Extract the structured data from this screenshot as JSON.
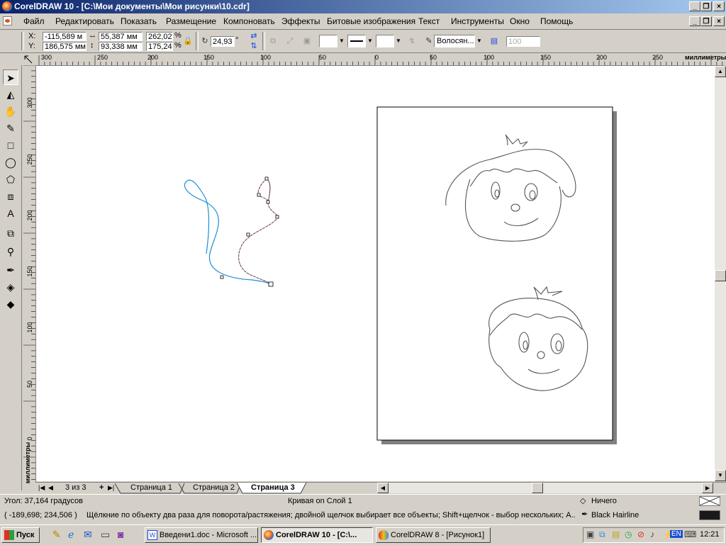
{
  "window": {
    "title": "CorelDRAW 10 - [C:\\Мои документы\\Мои рисунки\\10.cdr]"
  },
  "menu": {
    "items": [
      "Файл",
      "Редактировать",
      "Показать",
      "Размещение",
      "Компоновать",
      "Эффекты",
      "Битовые изображения",
      "Текст",
      "Инструменты",
      "Окно",
      "Помощь"
    ]
  },
  "propbar": {
    "x_label": "X:",
    "x_value": "-115,589 м",
    "y_label": "Y:",
    "y_value": "186,575 мм",
    "width_value": "55,387 мм",
    "height_value": "93,338 мм",
    "scale_x": "262,02",
    "scale_y": "175,24",
    "percent": "%",
    "angle_value": "24,93",
    "angle_unit": "°",
    "outline_width": "Волосян...",
    "nib_value": "100"
  },
  "ruler": {
    "unit": "миллиметры",
    "h_ticks": [
      "300",
      "250",
      "200",
      "150",
      "100",
      "50",
      "0",
      "50",
      "100",
      "150",
      "200",
      "250"
    ],
    "v_ticks": [
      "300",
      "250",
      "200",
      "150",
      "100",
      "50",
      "0"
    ]
  },
  "pages": {
    "counter": "3 из 3",
    "tabs": [
      "Страница 1",
      "Страница 2",
      "Страница 3"
    ],
    "active_index": 2
  },
  "status": {
    "angle": "Угол: 37,164 градусов",
    "object": "Кривая on Слой 1",
    "fill": "Ничего",
    "coords": "( -189,698; 234,506 )",
    "hint": "Щёлкние по объекту два раза для поворота/растяжения; двойной щелчок выбирает все объекты; Shift+щелчок - выбор нескольких; A...",
    "outline": "Black  Hairline",
    "outline_color": "#1a1a1a"
  },
  "taskbar": {
    "start": "Пуск",
    "buttons": [
      "Введени1.doc - Microsoft ...",
      "CorelDRAW 10 - [C:\\...",
      "CorelDRAW 8 - [Рисунок1]"
    ],
    "active_index": 1,
    "clock": "12:21",
    "lang": "EN"
  },
  "colors": {
    "title_start": "#0a246a",
    "title_end": "#a6caf0",
    "curve_blue": "#1a8fd6",
    "curve_selected": "#6a3a3a"
  }
}
